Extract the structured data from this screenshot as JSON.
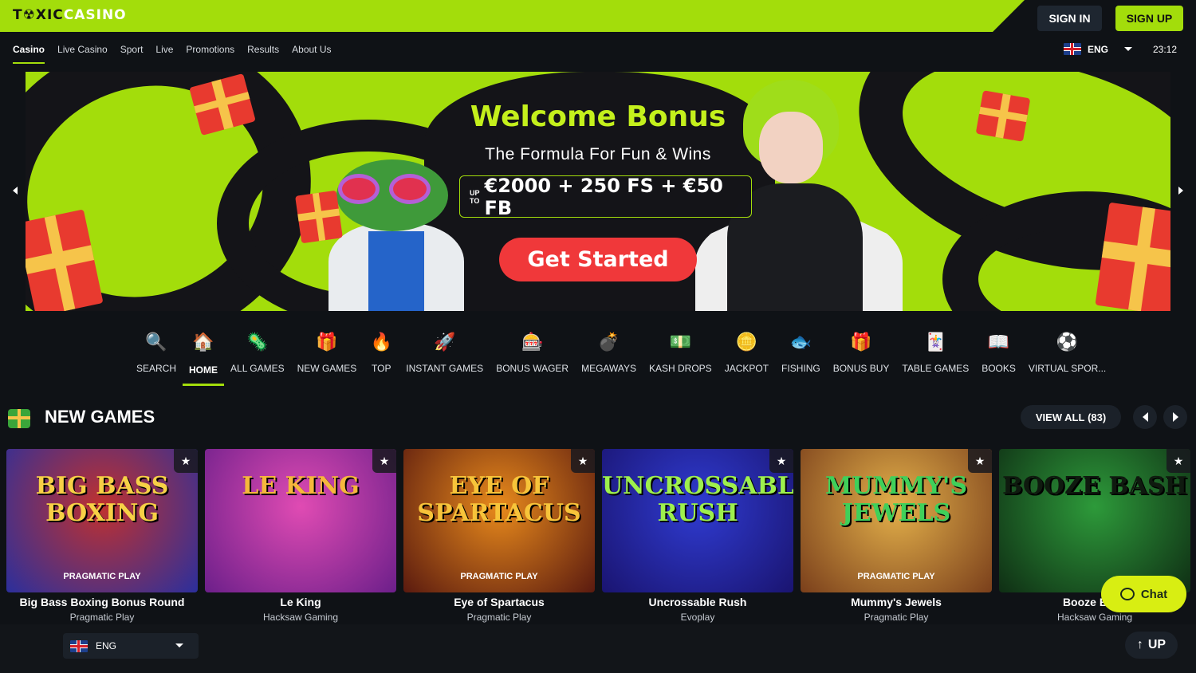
{
  "brand": {
    "logo_main": "T☢XIC",
    "logo_accent": "CASINO",
    "accent_color": "#a3dd0b"
  },
  "header": {
    "sign_in": "SIGN IN",
    "sign_up": "SIGN UP",
    "language": "ENG",
    "time": "23:12"
  },
  "nav": [
    {
      "label": "Casino",
      "active": true
    },
    {
      "label": "Live Casino"
    },
    {
      "label": "Sport"
    },
    {
      "label": "Live"
    },
    {
      "label": "Promotions"
    },
    {
      "label": "Results"
    },
    {
      "label": "About Us"
    }
  ],
  "hero": {
    "title": "Welcome Bonus",
    "subtitle": "The Formula For Fun & Wins",
    "upto_line1": "UP",
    "upto_line2": "TO",
    "offer": "€2000 + 250 FS + €50 FB",
    "cta": "Get Started"
  },
  "categories": [
    {
      "label": "SEARCH",
      "icon": "magnifier-icon",
      "glyph": "🔍"
    },
    {
      "label": "HOME",
      "icon": "house-icon",
      "glyph": "🏠",
      "active": true
    },
    {
      "label": "ALL GAMES",
      "icon": "virus-icon",
      "glyph": "🦠"
    },
    {
      "label": "NEW GAMES",
      "icon": "gift-box-icon",
      "glyph": "🎁"
    },
    {
      "label": "TOP",
      "icon": "flame-icon",
      "glyph": "🔥"
    },
    {
      "label": "INSTANT GAMES",
      "icon": "rocket-icon",
      "glyph": "🚀"
    },
    {
      "label": "BONUS WAGER",
      "icon": "slot-machine-icon",
      "glyph": "🎰"
    },
    {
      "label": "MEGAWAYS",
      "icon": "bomb-icon",
      "glyph": "💣"
    },
    {
      "label": "KASH DROPS",
      "icon": "cash-icon",
      "glyph": "💵"
    },
    {
      "label": "JACKPOT",
      "icon": "coin-icon",
      "glyph": "🪙"
    },
    {
      "label": "FISHING",
      "icon": "fish-icon",
      "glyph": "🐟"
    },
    {
      "label": "BONUS BUY",
      "icon": "present-icon",
      "glyph": "🎁"
    },
    {
      "label": "TABLE GAMES",
      "icon": "cards-icon",
      "glyph": "🃏"
    },
    {
      "label": "BOOKS",
      "icon": "book-icon",
      "glyph": "📖"
    },
    {
      "label": "VIRTUAL SPOR...",
      "icon": "virtual-sports-icon",
      "glyph": "⚽"
    }
  ],
  "new_games": {
    "title": "NEW GAMES",
    "view_all": "VIEW ALL",
    "count": "(83)",
    "games": [
      {
        "name": "Big Bass Boxing Bonus Round",
        "provider": "Pragmatic Play",
        "art": "BIG BASS BOXING",
        "tag": "PRAGMATIC PLAY",
        "bg1": "#c0312f",
        "bg2": "#2b2f9c",
        "art_color": "#f7d046"
      },
      {
        "name": "Le King",
        "provider": "Hacksaw Gaming",
        "art": "LE KING",
        "tag": "",
        "bg1": "#e04bb3",
        "bg2": "#6c1f8a",
        "art_color": "#f6b73c"
      },
      {
        "name": "Eye of Spartacus",
        "provider": "Pragmatic Play",
        "art": "EYE OF SPARTACUS",
        "tag": "PRAGMATIC PLAY",
        "bg1": "#e88a1c",
        "bg2": "#5a1a0f",
        "art_color": "#f7c43a"
      },
      {
        "name": "Uncrossable Rush",
        "provider": "Evoplay",
        "art": "UNCROSSABLE RUSH",
        "tag": "",
        "bg1": "#2f3bd1",
        "bg2": "#1a1470",
        "art_color": "#9ef04d"
      },
      {
        "name": "Mummy's Jewels",
        "provider": "Pragmatic Play",
        "art": "MUMMY'S JEWELS",
        "tag": "PRAGMATIC PLAY",
        "bg1": "#e3b04a",
        "bg2": "#7a3f1b",
        "art_color": "#3fd05a"
      },
      {
        "name": "Booze Bash",
        "provider": "Hacksaw Gaming",
        "art": "BOOZE BASH",
        "tag": "",
        "bg1": "#2d9a3a",
        "bg2": "#0f2e14",
        "art_color": "#0f1a0f"
      }
    ]
  },
  "footer": {
    "language": "ENG",
    "up": "UP",
    "chat": "Chat"
  }
}
